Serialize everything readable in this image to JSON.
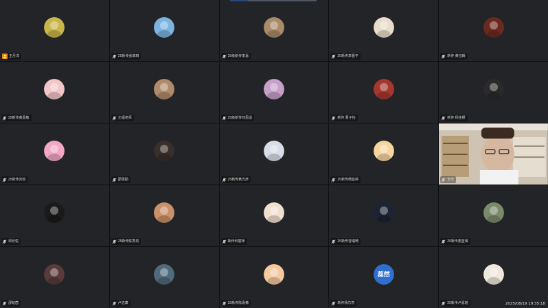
{
  "meeting": {
    "timestamp": "2025/08/19 19:35:18"
  },
  "participants": [
    {
      "name": "王丹洋",
      "host": true,
      "avatar": "yellow-sticker-avatar",
      "color": "#c9b64a"
    },
    {
      "name": "25新传张菲琳",
      "host": false,
      "avatar": "blue-sky-dog-avatar",
      "color": "#7cb4e0"
    },
    {
      "name": "25级新传李嘉",
      "host": false,
      "avatar": "hamster-avatar",
      "color": "#a98b6a"
    },
    {
      "name": "25新传李晋平",
      "host": false,
      "avatar": "white-dog-avatar",
      "color": "#e9dccb"
    },
    {
      "name": "新传 黄钰晴",
      "host": false,
      "avatar": "brown-cartoon-avatar",
      "color": "#6b2a1f"
    },
    {
      "name": "25新传黄嘉敏",
      "host": false,
      "avatar": "pink-cartoon-avatar",
      "color": "#f3c6c8"
    },
    {
      "name": "允福老师",
      "host": false,
      "avatar": "girl-photo-avatar",
      "color": "#b08a6a"
    },
    {
      "name": "25级新传刘思遥",
      "host": false,
      "avatar": "plush-toy-avatar",
      "color": "#c6a0c8"
    },
    {
      "name": "新传 曹子怡",
      "host": false,
      "avatar": "red-cartoon-avatar",
      "color": "#a5372e"
    },
    {
      "name": "新传 杨佳颖",
      "host": false,
      "avatar": "black-doll-avatar",
      "color": "#2a2a2a"
    },
    {
      "name": "25新传刘怡",
      "host": false,
      "avatar": "pink-bear-avatar",
      "color": "#f2a8c4"
    },
    {
      "name": "邵梁勤",
      "host": false,
      "avatar": "dark-girl-avatar",
      "color": "#3a2e2a"
    },
    {
      "name": "25新传黄方彦",
      "host": false,
      "avatar": "white-cat-avatar",
      "color": "#d8dde8"
    },
    {
      "name": "25新传杨蓝婷",
      "host": false,
      "avatar": "cartoon-kid-avatar",
      "color": "#f6d6a0"
    },
    {
      "name": "安乐",
      "host": false,
      "avatar": "video-feed",
      "color": "#9e8a70",
      "video": true
    },
    {
      "name": "邓欣悦",
      "host": false,
      "avatar": "white-smoke-avatar",
      "color": "#1a1a1a"
    },
    {
      "name": "25新传陈秀玟",
      "host": false,
      "avatar": "girl-smile-avatar",
      "color": "#c9906a"
    },
    {
      "name": "新传科丽萍",
      "host": false,
      "avatar": "boy-cartoon-avatar",
      "color": "#f1e0cf"
    },
    {
      "name": "25新传曾瑞琦",
      "host": false,
      "avatar": "night-sky-avatar",
      "color": "#1c2433"
    },
    {
      "name": "25新传麦蓝晴",
      "host": false,
      "avatar": "outdoor-girl-avatar",
      "color": "#7a8a6a"
    },
    {
      "name": "邵韬茵",
      "host": false,
      "avatar": "portrait-avatar",
      "color": "#5a3b3b"
    },
    {
      "name": "卢志康",
      "host": false,
      "avatar": "landscape-avatar",
      "color": "#4f6a7a"
    },
    {
      "name": "25新传陈嘉薇",
      "host": false,
      "avatar": "orange-cartoon-avatar",
      "color": "#f4c9a0"
    },
    {
      "name": "新传杨芯然",
      "host": false,
      "avatar": "text-avatar",
      "color": "#2f6fd0",
      "text": "蕊然"
    },
    {
      "name": "25新传卢嘉瑶",
      "host": false,
      "avatar": "white-puppy-avatar",
      "color": "#efe8dc"
    }
  ]
}
